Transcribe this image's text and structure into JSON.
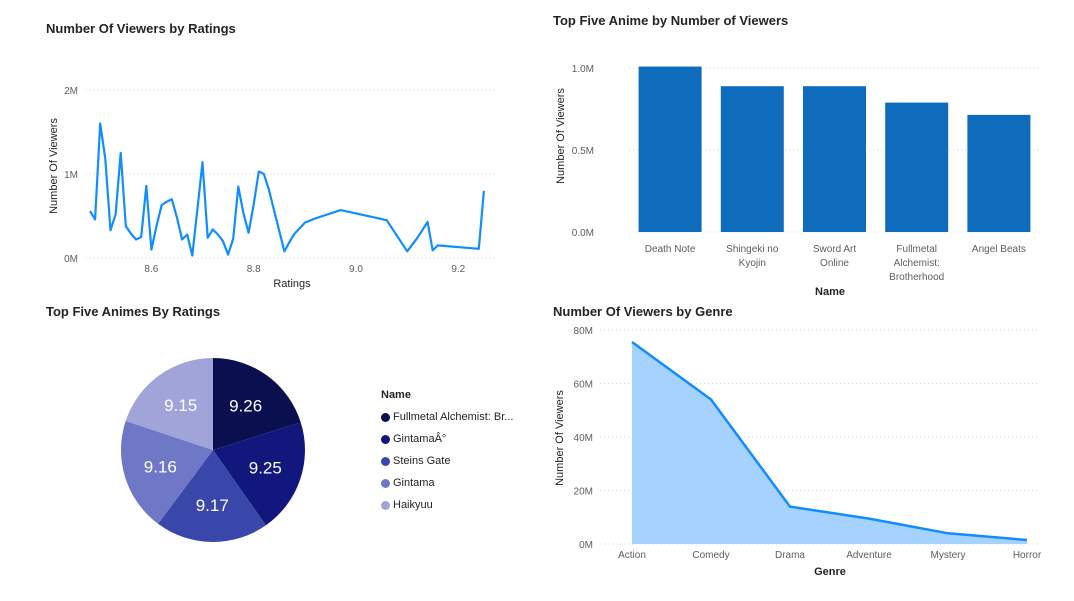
{
  "chart_data": [
    {
      "id": "viewers_by_ratings",
      "type": "line",
      "title": "Number Of Viewers by Ratings",
      "xlabel": "Ratings",
      "ylabel": "Number Of Viewers",
      "xlim": [
        8.48,
        9.26
      ],
      "ylim": [
        0,
        2000000
      ],
      "xticks": [
        {
          "v": 8.6,
          "label": "8.6"
        },
        {
          "v": 8.8,
          "label": "8.8"
        },
        {
          "v": 9.0,
          "label": "9.0"
        },
        {
          "v": 9.2,
          "label": "9.2"
        }
      ],
      "yticks": [
        {
          "v": 0,
          "label": "0M"
        },
        {
          "v": 1000000,
          "label": "1M"
        },
        {
          "v": 2000000,
          "label": "2M"
        }
      ],
      "grid": true,
      "color": "#118DFF",
      "x": [
        8.48,
        8.49,
        8.5,
        8.51,
        8.52,
        8.53,
        8.54,
        8.55,
        8.56,
        8.57,
        8.58,
        8.59,
        8.6,
        8.61,
        8.62,
        8.63,
        8.64,
        8.65,
        8.66,
        8.67,
        8.68,
        8.69,
        8.7,
        8.71,
        8.72,
        8.73,
        8.74,
        8.75,
        8.76,
        8.77,
        8.78,
        8.79,
        8.8,
        8.81,
        8.82,
        8.83,
        8.84,
        8.85,
        8.86,
        8.87,
        8.88,
        8.9,
        8.92,
        8.97,
        9.06,
        9.1,
        9.12,
        9.14,
        9.15,
        9.16,
        9.24,
        9.25
      ],
      "y": [
        560000,
        460000,
        1600000,
        1180000,
        330000,
        520000,
        1250000,
        380000,
        290000,
        220000,
        250000,
        860000,
        100000,
        380000,
        630000,
        670000,
        700000,
        480000,
        220000,
        280000,
        30000,
        580000,
        1140000,
        240000,
        340000,
        280000,
        200000,
        40000,
        230000,
        850000,
        530000,
        300000,
        640000,
        1030000,
        1000000,
        810000,
        560000,
        320000,
        80000,
        190000,
        290000,
        420000,
        470000,
        570000,
        450000,
        80000,
        240000,
        430000,
        90000,
        150000,
        110000,
        800000
      ]
    },
    {
      "id": "top5_by_viewers",
      "type": "bar",
      "title": "Top Five Anime by Number of Viewers",
      "xlabel": "Name",
      "ylabel": "Number Of Viewers",
      "ylim": [
        0,
        1050000
      ],
      "yticks": [
        {
          "v": 0,
          "label": "0.0M"
        },
        {
          "v": 500000,
          "label": "0.5M"
        },
        {
          "v": 1000000,
          "label": "1.0M"
        }
      ],
      "grid": true,
      "color": "#0F6CBD",
      "categories": [
        [
          "Death Note"
        ],
        [
          "Shingeki no",
          "Kyojin"
        ],
        [
          "Sword Art",
          "Online"
        ],
        [
          "Fullmetal",
          "Alchemist:",
          "Brotherhood"
        ],
        [
          "Angel Beats"
        ]
      ],
      "values": [
        1010000,
        890000,
        890000,
        790000,
        715000
      ]
    },
    {
      "id": "top5_by_ratings",
      "type": "pie",
      "title": "Top Five Animes By Ratings",
      "legend_title": "Name",
      "legend_position": "right",
      "slices": [
        {
          "name": "Fullmetal Alchemist: Br...",
          "value": 9.26,
          "label": "9.26",
          "color": "#0A0F50"
        },
        {
          "name": "GintamaÂ°",
          "value": 9.25,
          "label": "9.25",
          "color": "#12177E"
        },
        {
          "name": "Steins Gate",
          "value": 9.17,
          "label": "9.17",
          "color": "#3A47AA"
        },
        {
          "name": "Gintama",
          "value": 9.16,
          "label": "9.16",
          "color": "#6E78C6"
        },
        {
          "name": "Haikyuu",
          "value": 9.15,
          "label": "9.15",
          "color": "#A0A4D8"
        }
      ]
    },
    {
      "id": "viewers_by_genre",
      "type": "area",
      "title": "Number Of Viewers by Genre",
      "xlabel": "Genre",
      "ylabel": "Number Of Viewers",
      "ylim": [
        0,
        80000000
      ],
      "yticks": [
        {
          "v": 0,
          "label": "0M"
        },
        {
          "v": 20000000,
          "label": "20M"
        },
        {
          "v": 40000000,
          "label": "40M"
        },
        {
          "v": 60000000,
          "label": "60M"
        },
        {
          "v": 80000000,
          "label": "80M"
        }
      ],
      "grid": true,
      "line_color": "#118DFF",
      "fill_color": "#A6D2FF",
      "categories": [
        "Action",
        "Comedy",
        "Drama",
        "Adventure",
        "Mystery",
        "Horror"
      ],
      "values": [
        75500000,
        54000000,
        14000000,
        9500000,
        4000000,
        1500000
      ]
    }
  ]
}
